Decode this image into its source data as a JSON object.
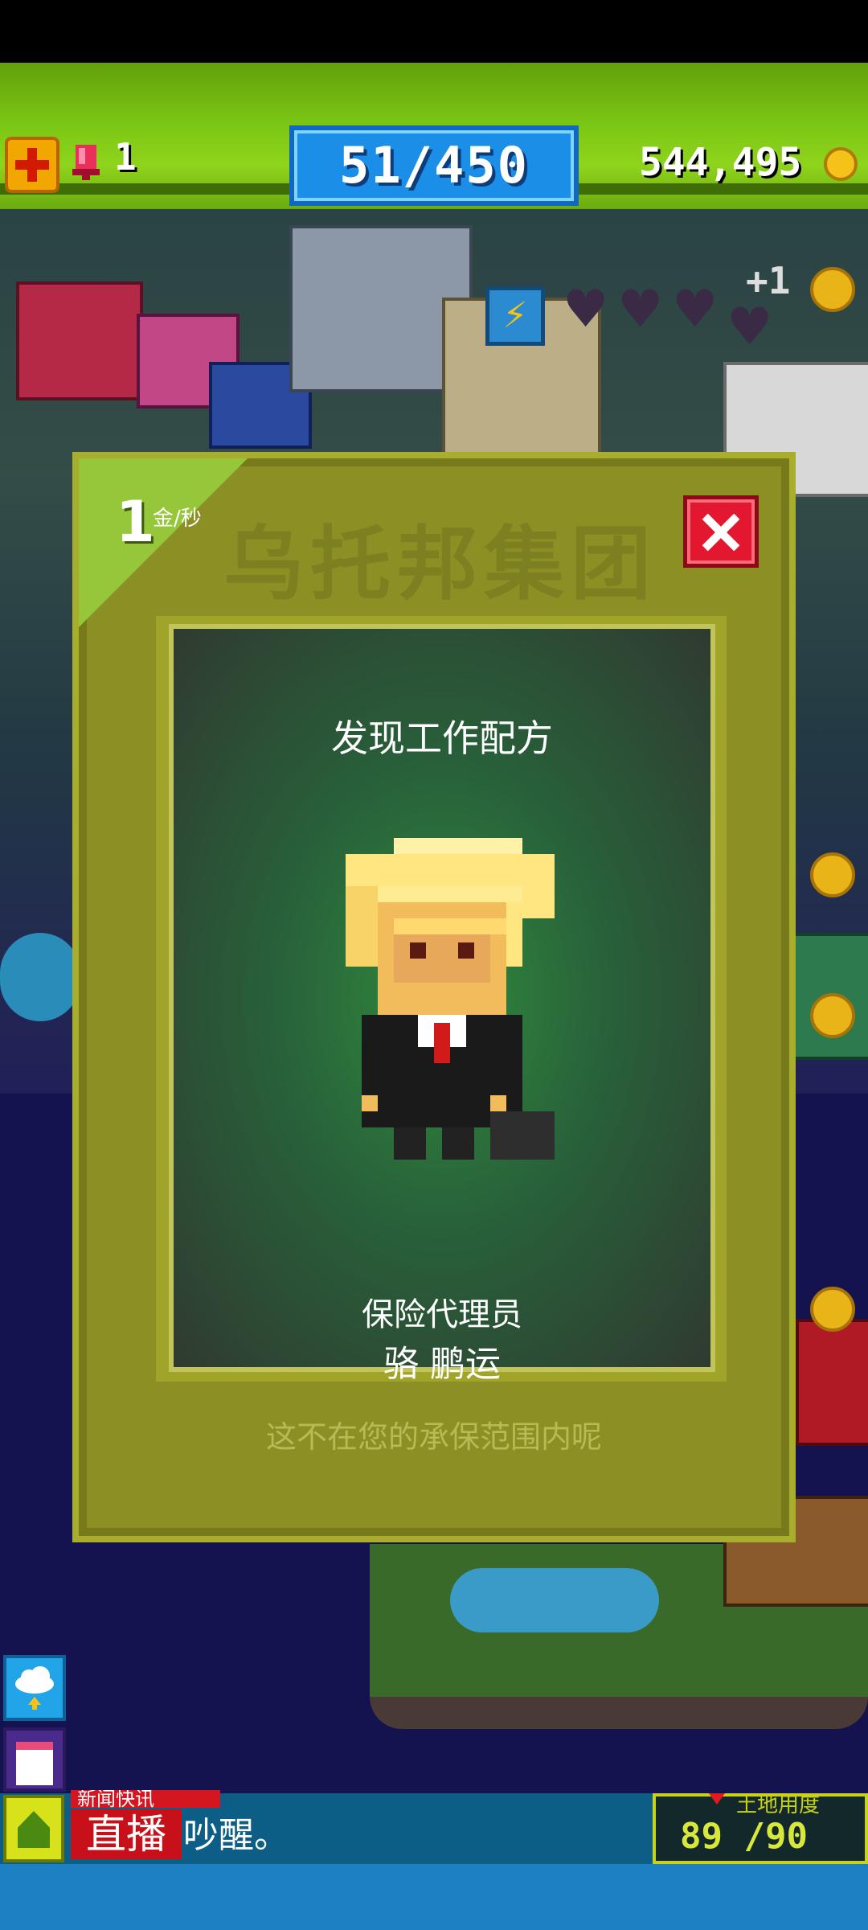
{
  "hud": {
    "gem_count": "1",
    "population": "51/450",
    "coins": "544,495"
  },
  "world": {
    "plus_one": "+1"
  },
  "dialog": {
    "watermark": "乌托邦集团",
    "rate_value": "1",
    "rate_unit": "金/秒",
    "card_title": "发现工作配方",
    "job_title": "保险代理员",
    "worker_name": "骆 鹏运",
    "flavor_text": "这不在您的承保范围内呢"
  },
  "news": {
    "tag": "新闻快讯",
    "live": "直播",
    "text": "震动声吵醒。"
  },
  "land": {
    "label": "土地用度",
    "value": "89 /90"
  },
  "colors": {
    "hud_green": "#79c514",
    "population_blue": "#1b8ee8",
    "dialog_olive": "#8c8f24",
    "close_red": "#e3172f",
    "news_red": "#d5151f"
  }
}
